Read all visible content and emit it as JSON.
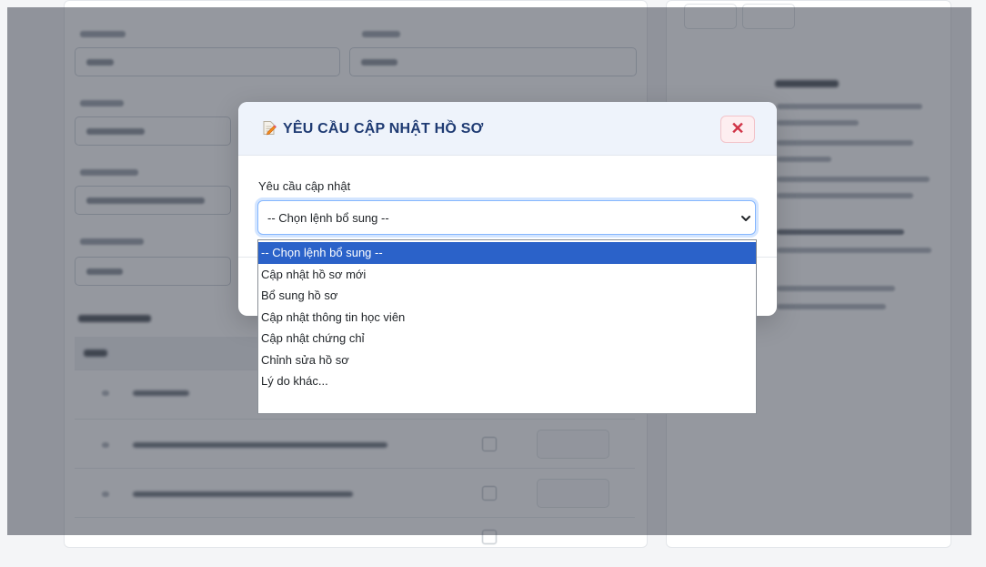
{
  "modal": {
    "title": "YÊU CẦU CẬP NHẬT HỒ SƠ",
    "title_icon": "edit-document-icon",
    "close_icon": "close-x-icon",
    "close_label": "✕",
    "field_label": "Yêu cầu cập nhật",
    "select": {
      "value": "-- Chọn lệnh bổ sung --",
      "caret_icon": "chevron-down-icon"
    }
  },
  "dropdown": {
    "options": [
      "-- Chọn lệnh bổ sung --",
      "Cập nhật hồ sơ mới",
      "Bổ sung hồ sơ",
      "Cập nhật thông tin học viên",
      "Cập nhật chứng chỉ",
      "Chỉnh sửa hồ sơ",
      "Lý do khác..."
    ],
    "selected_index": 0
  },
  "colors": {
    "title": "#1f3b73",
    "close": "#d13447",
    "highlight": "#2b62c9",
    "focus_border": "#86b7fe"
  }
}
